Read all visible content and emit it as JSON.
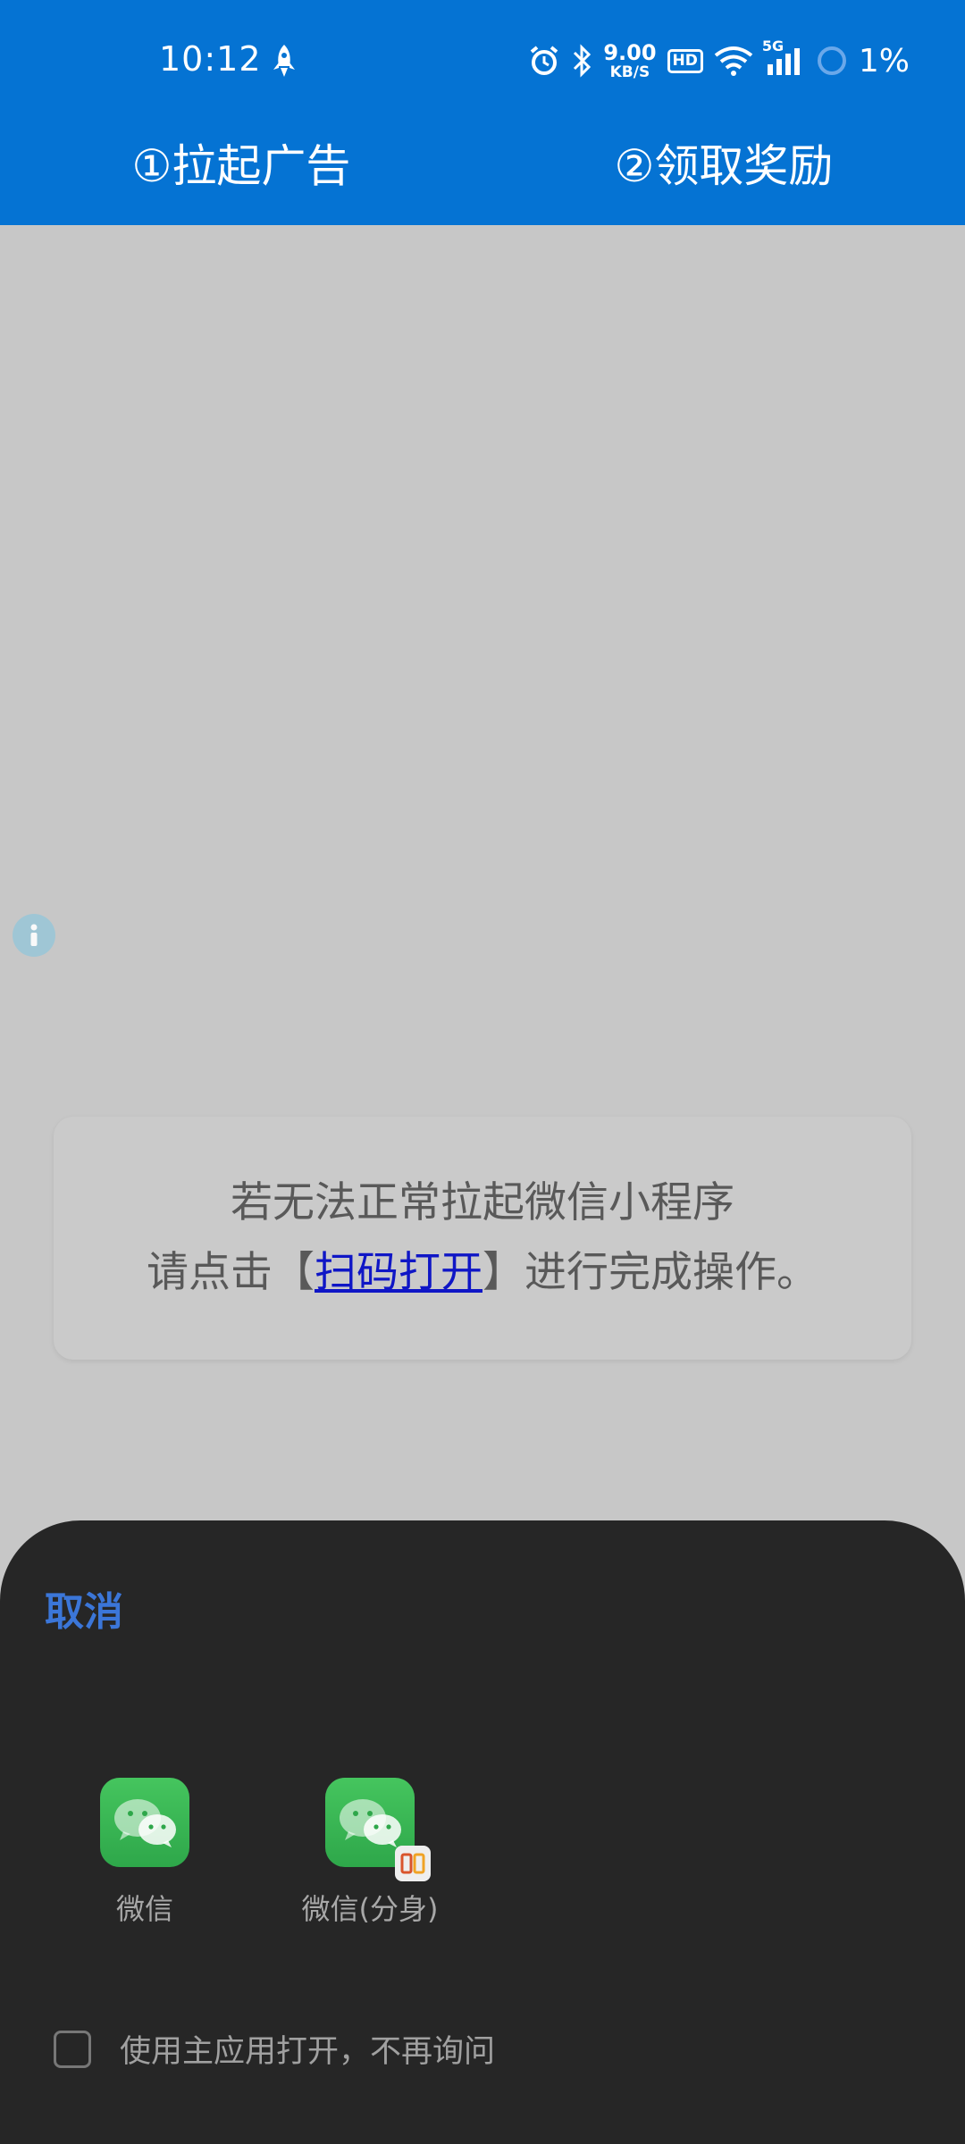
{
  "status_bar": {
    "time": "10:12",
    "net_speed_value": "9.00",
    "net_speed_unit": "KB/S",
    "hd_badge": "HD",
    "network_type": "5G",
    "battery": "1%"
  },
  "tabs": [
    {
      "label": "①拉起广告"
    },
    {
      "label": "②领取奖励"
    }
  ],
  "notice": {
    "line1": "若无法正常拉起微信小程序",
    "line2_prefix": "请点击【",
    "line2_link": "扫码打开",
    "line2_suffix": "】进行完成操作。"
  },
  "sheet": {
    "cancel_label": "取消",
    "apps": [
      {
        "label": "微信"
      },
      {
        "label": "微信(分身)"
      }
    ],
    "remember_label": "使用主应用打开，不再询问"
  },
  "colors": {
    "header": "#0573d3",
    "background": "#c7c7c7",
    "sheet": "#262626",
    "cancel": "#3b76d8",
    "link": "#0f16c6",
    "wechat_green": "#3cb955"
  }
}
